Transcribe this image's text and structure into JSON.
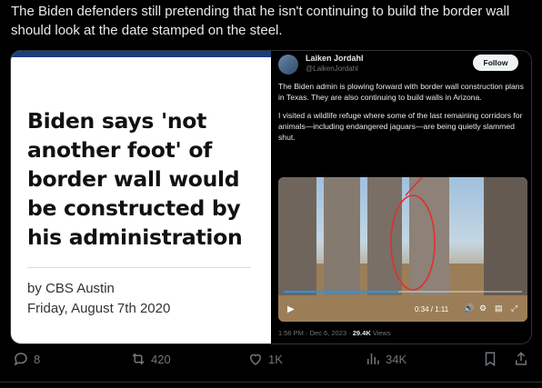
{
  "post": {
    "text": "The Biden defenders still pretending that he isn't continuing to build the border wall should look at the date stamped on the steel."
  },
  "article_card": {
    "headline": "Biden says 'not another foot' of border wall would be constructed by his administration",
    "byline": "by CBS Austin",
    "date": "Friday, August 7th 2020"
  },
  "quoted_tweet": {
    "name": "Laiken Jordahl",
    "handle": "@LaikenJordahl",
    "follow_label": "Follow",
    "paragraph1": "The Biden admin is plowing forward with border wall construction plans in Texas. They are also continuing to build walls in Arizona.",
    "paragraph2": "I visited a wildlife refuge where some of the last remaining corridors for animals—including endangered jaguars—are being quietly slammed shut.",
    "time": "1:56 PM · Dec 6, 2023 · ",
    "views_count": "29.4K",
    "views_label": " Views",
    "video": {
      "time": "0:34 / 1:11",
      "progress": 0.48
    }
  },
  "actions": {
    "replies": "8",
    "reposts": "420",
    "likes": "1K",
    "views": "34K"
  },
  "colors": {
    "accent": "#1d9bf0",
    "muted": "#71767b",
    "circle_annotation": "#e0302a"
  }
}
